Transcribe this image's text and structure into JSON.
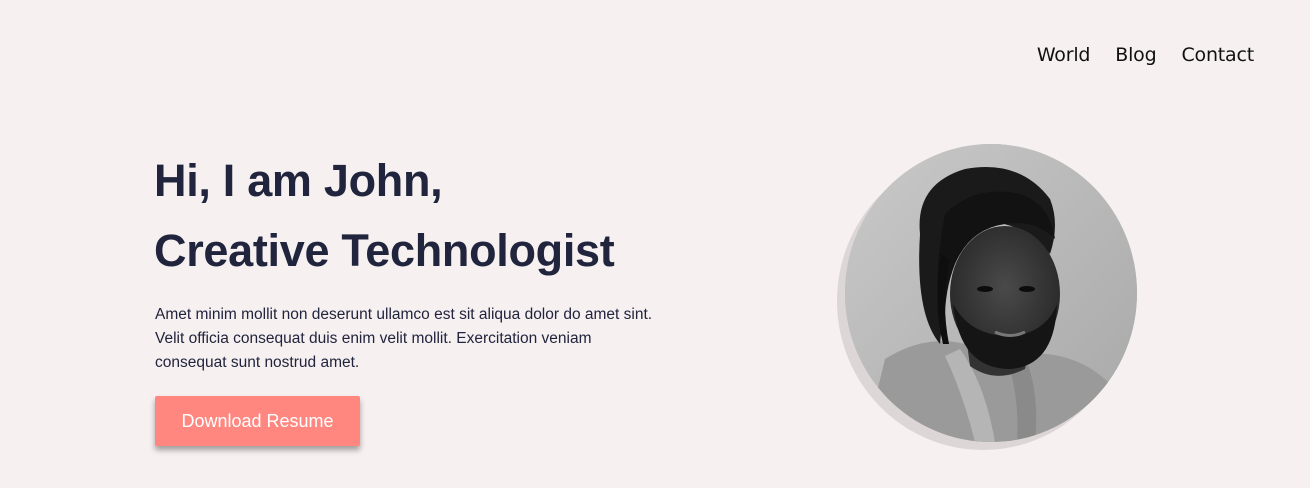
{
  "nav": {
    "items": [
      {
        "label": "World"
      },
      {
        "label": "Blog"
      },
      {
        "label": "Contact"
      }
    ]
  },
  "hero": {
    "title_line1": "Hi, I am John,",
    "title_line2": "Creative Technologist",
    "description": "Amet minim mollit non deserunt ullamco est sit aliqua dolor do amet sint. Velit officia consequat duis enim velit mollit. Exercitation veniam consequat sunt nostrud amet.",
    "button_label": "Download Resume"
  },
  "colors": {
    "background": "#f6f0f0",
    "heading": "#21243d",
    "accent": "#ff8780"
  },
  "avatar": {
    "alt": "Profile photo"
  }
}
